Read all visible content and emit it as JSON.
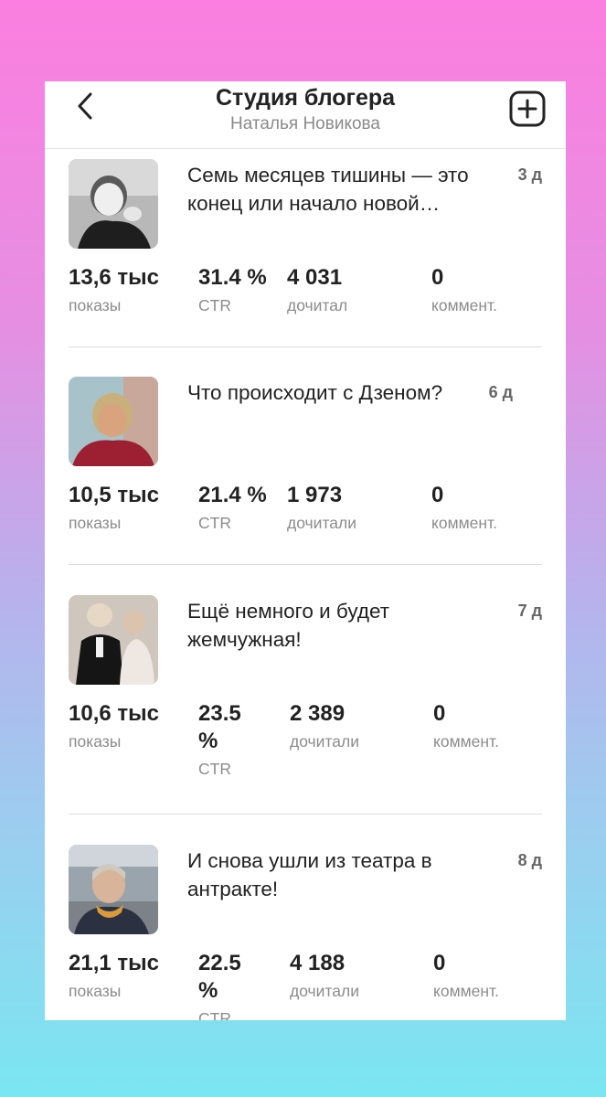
{
  "header": {
    "title": "Студия блогера",
    "subtitle": "Наталья Новикова"
  },
  "articles": [
    {
      "headline": "Семь месяцев тишины — это конец или начало новой…",
      "age": "3 д",
      "views": "13,6 тыс",
      "views_label": "показы",
      "ctr": "31.4 %",
      "ctr_label": "CTR",
      "reads": "4 031",
      "reads_label": "дочитал",
      "comments": "0",
      "comments_label": "коммент."
    },
    {
      "headline": "Что происходит с Дзеном?",
      "age": "6 д",
      "views": "10,5 тыс",
      "views_label": "показы",
      "ctr": "21.4 %",
      "ctr_label": "CTR",
      "reads": "1 973",
      "reads_label": "дочитали",
      "comments": "0",
      "comments_label": "коммент."
    },
    {
      "headline": "Ещё немного и будет жемчужная!",
      "age": "7 д",
      "views": "10,6 тыс",
      "views_label": "показы",
      "ctr": "23.5 %",
      "ctr_label": "CTR",
      "reads": "2 389",
      "reads_label": "дочитали",
      "comments": "0",
      "comments_label": "коммент."
    },
    {
      "headline": "И снова ушли из театра в антракте!",
      "age": "8 д",
      "views": "21,1 тыс",
      "views_label": "показы",
      "ctr": "22.5 %",
      "ctr_label": "CTR",
      "reads": "4 188",
      "reads_label": "дочитали",
      "comments": "0",
      "comments_label": "коммент."
    }
  ],
  "icons": {
    "back": "chevron-left-icon",
    "add": "plus-square-icon"
  },
  "colors": {
    "text": "#222222",
    "muted": "#8c8c8c",
    "divider": "#dcdcdc"
  }
}
